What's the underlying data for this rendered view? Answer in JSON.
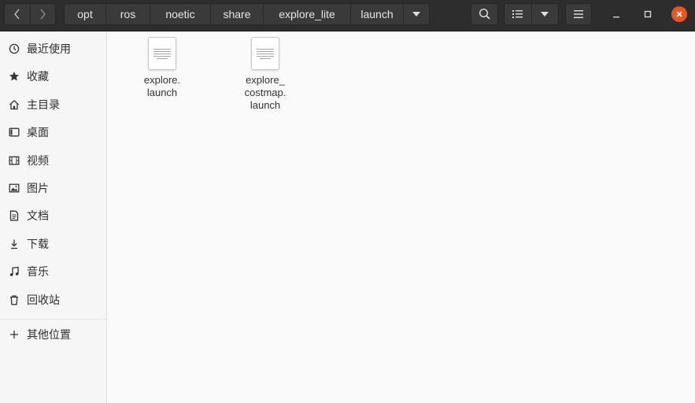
{
  "pathbar": {
    "crumbs": [
      "opt",
      "ros",
      "noetic",
      "share",
      "explore_lite",
      "launch"
    ]
  },
  "header": {
    "back_icon": "chevron-left-icon",
    "forward_icon": "chevron-right-icon",
    "search_icon": "search-icon",
    "view_icon": "list-view-icon",
    "menu_icon": "hamburger-menu-icon"
  },
  "colors": {
    "headerbar": "#2d2d2d",
    "close_button": "#e95420",
    "sidebar_bg": "#f6f6f6",
    "content_bg": "#fafafa"
  },
  "sidebar": {
    "items": [
      {
        "label": "最近使用",
        "icon": "clock-icon"
      },
      {
        "label": "收藏",
        "icon": "star-icon"
      },
      {
        "label": "主目录",
        "icon": "home-icon"
      },
      {
        "label": "桌面",
        "icon": "desktop-icon"
      },
      {
        "label": "视频",
        "icon": "video-icon"
      },
      {
        "label": "图片",
        "icon": "image-icon"
      },
      {
        "label": "文档",
        "icon": "document-icon"
      },
      {
        "label": "下载",
        "icon": "download-icon"
      },
      {
        "label": "音乐",
        "icon": "music-icon"
      },
      {
        "label": "回收站",
        "icon": "trash-icon"
      }
    ],
    "other_locations": {
      "label": "其他位置",
      "icon": "plus-icon"
    }
  },
  "files": [
    {
      "name": "explore.\nlaunch",
      "icon": "text-file-icon"
    },
    {
      "name": "explore_\ncostmap.\nlaunch",
      "icon": "text-file-icon"
    }
  ]
}
